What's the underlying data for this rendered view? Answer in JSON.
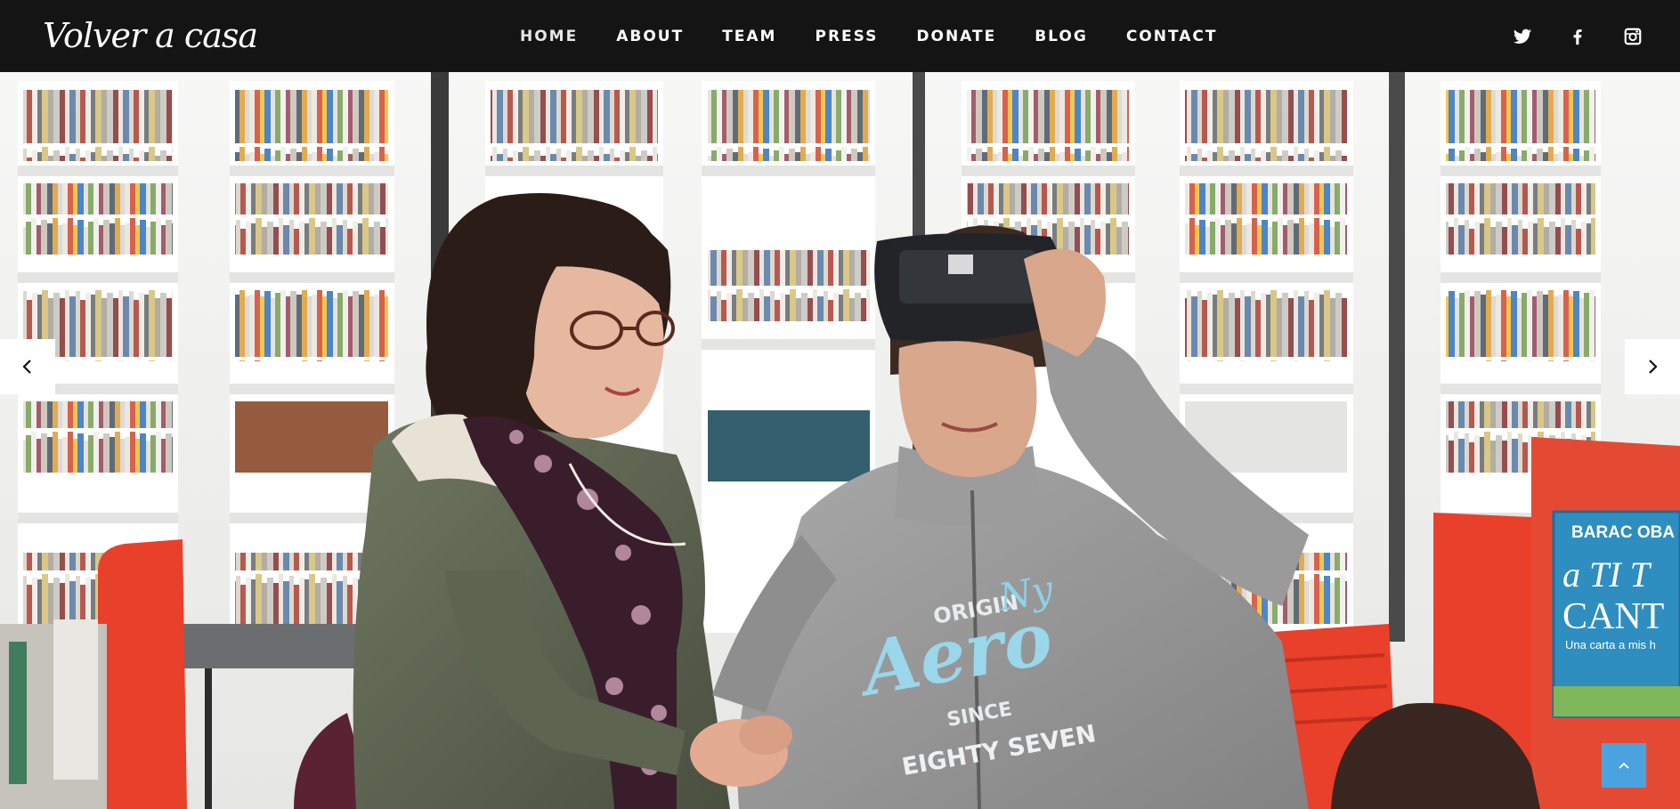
{
  "brand": {
    "logo_text": "Volver a casa"
  },
  "nav": {
    "items": [
      {
        "label": "HOME"
      },
      {
        "label": "ABOUT"
      },
      {
        "label": "TEAM"
      },
      {
        "label": "PRESS"
      },
      {
        "label": "DONATE"
      },
      {
        "label": "BLOG"
      },
      {
        "label": "CONTACT"
      }
    ]
  },
  "social": {
    "icons": [
      "twitter-icon",
      "facebook-icon",
      "instagram-icon"
    ]
  },
  "hero": {
    "sweatshirt_text": {
      "line1": "ORIGIN",
      "line2": "Ny",
      "line3": "Aero",
      "line4": "SINCE",
      "line5": "EIGHTY SEVEN"
    },
    "book_text": {
      "line1": "BARAC OBA",
      "line2": "a TI T",
      "line3": "CANT",
      "line4": "Una carta a mis h"
    }
  },
  "colors": {
    "header_bg": "#141414",
    "accent": "#4aa3df",
    "chair_red": "#e8402a"
  }
}
